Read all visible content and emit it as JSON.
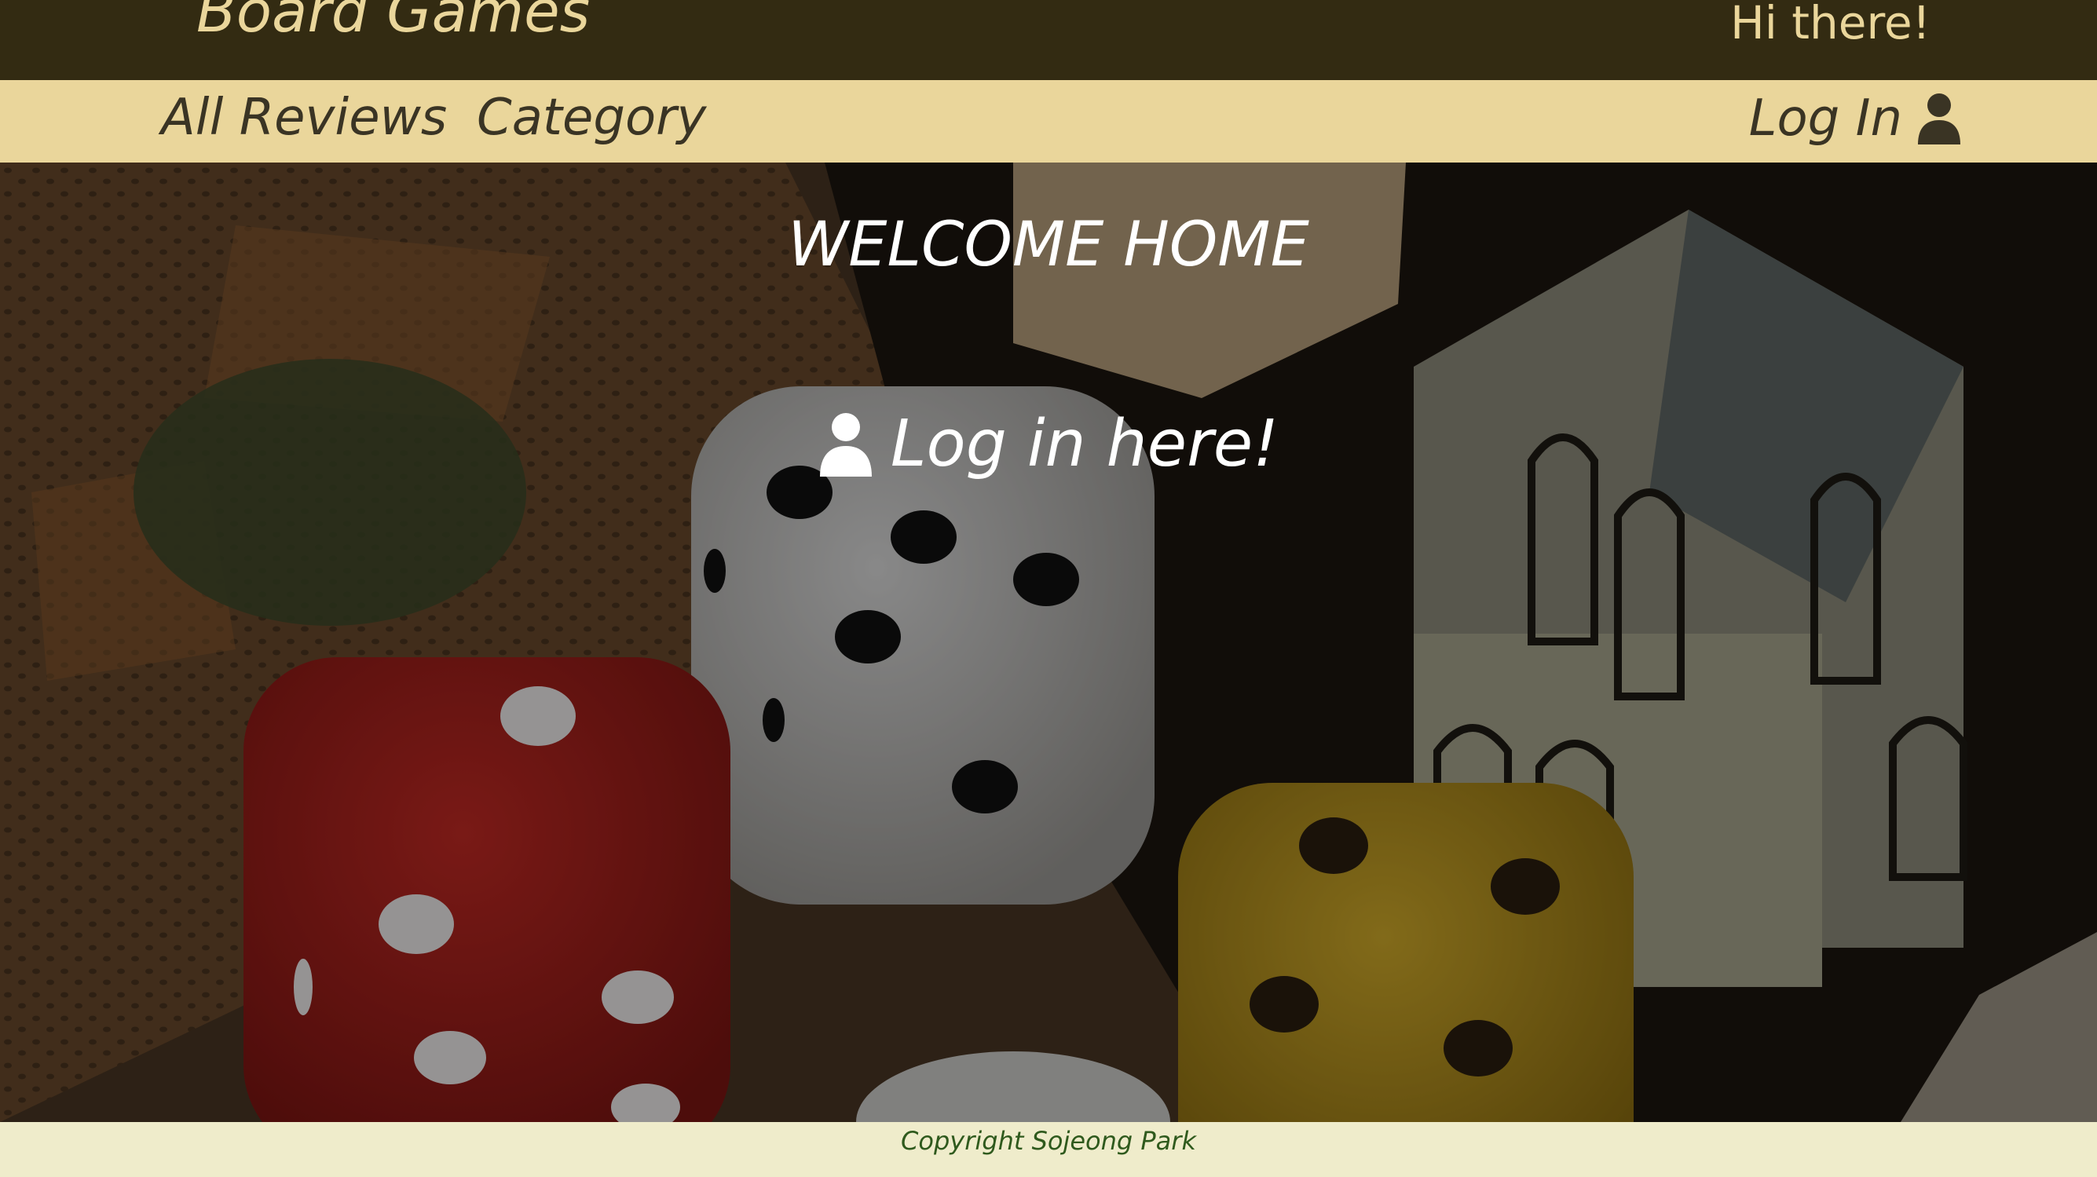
{
  "header": {
    "brand": "Board Games",
    "greeting": "Hi there!"
  },
  "nav": {
    "links": [
      {
        "label": "All Reviews"
      },
      {
        "label": "Category"
      }
    ],
    "login_label": "Log In",
    "login_icon": "user-icon"
  },
  "hero": {
    "title": "WELCOME HOME",
    "login_prompt": "Log in here!",
    "login_icon": "user-icon",
    "background": "photo of dice on a board game"
  },
  "footer": {
    "copyright": "Copyright Sojeong Park"
  },
  "colors": {
    "topbar": "#332b12",
    "navbar": "#ead69b",
    "brand_text": "#ead69b",
    "nav_text": "#3a3424",
    "footer_bg": "#efeccb",
    "footer_text": "#2f5a1d"
  }
}
